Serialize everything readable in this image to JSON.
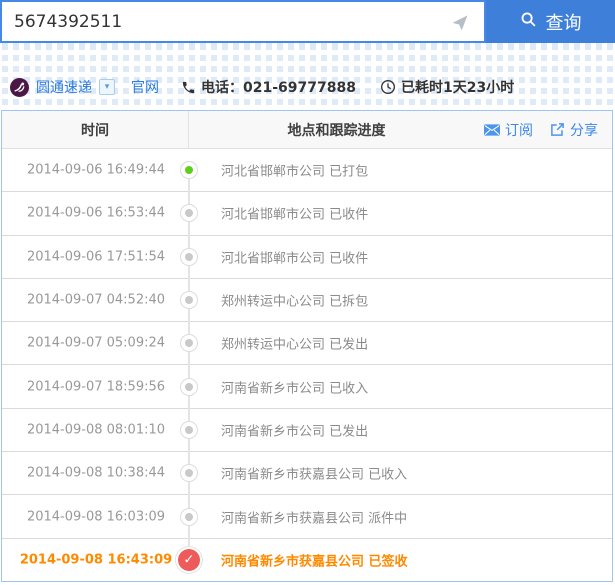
{
  "search": {
    "value": "5674392511",
    "button_label": "查询"
  },
  "courier": {
    "name": "圆通速递",
    "official_site_label": "官网",
    "phone_text": "电话：021-69777888",
    "elapsed_text": "已耗时1天23小时"
  },
  "table": {
    "col_time": "时间",
    "col_progress": "地点和跟踪进度",
    "subscribe_label": "订阅",
    "share_label": "分享"
  },
  "events": [
    {
      "time": "2014-09-06 16:49:44",
      "text": "河北省邯郸市公司 已打包",
      "marker": "green"
    },
    {
      "time": "2014-09-06 16:53:44",
      "text": "河北省邯郸市公司 已收件",
      "marker": "gray"
    },
    {
      "time": "2014-09-06 17:51:54",
      "text": "河北省邯郸市公司 已收件",
      "marker": "gray"
    },
    {
      "time": "2014-09-07 04:52:40",
      "text": "郑州转运中心公司 已拆包",
      "marker": "gray"
    },
    {
      "time": "2014-09-07 05:09:24",
      "text": "郑州转运中心公司 已发出",
      "marker": "gray"
    },
    {
      "time": "2014-09-07 18:59:56",
      "text": "河南省新乡市公司 已收入",
      "marker": "gray"
    },
    {
      "time": "2014-09-08 08:01:10",
      "text": "河南省新乡市公司 已发出",
      "marker": "gray"
    },
    {
      "time": "2014-09-08 10:38:44",
      "text": "河南省新乡市获嘉县公司 已收入",
      "marker": "gray"
    },
    {
      "time": "2014-09-08 16:03:09",
      "text": "河南省新乡市获嘉县公司 派件中",
      "marker": "gray"
    },
    {
      "time": "2014-09-08 16:43:09",
      "text": "河南省新乡市获嘉县公司 已签收",
      "marker": "check",
      "highlight": true
    }
  ],
  "icons": {
    "search": "search-icon",
    "send": "send-icon",
    "logo": "courier-logo",
    "phone": "phone-icon",
    "clock": "clock-icon",
    "mail": "mail-icon",
    "share": "share-icon"
  },
  "colors": {
    "accent": "#3e7fd9",
    "link": "#2a7ae0",
    "highlight": "#ff8a00",
    "success": "#5ecf1e",
    "danger": "#ee5b5b",
    "tableborder": "#9cc5f0",
    "muted": "#999999"
  }
}
